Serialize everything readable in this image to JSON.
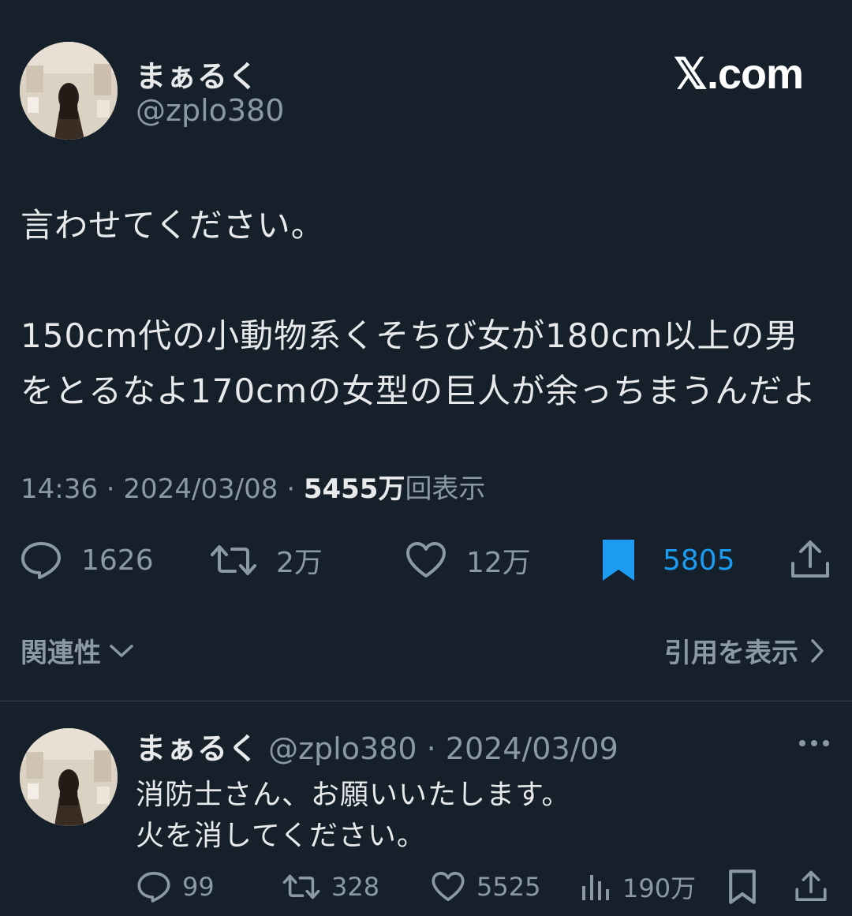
{
  "tweet": {
    "author": {
      "display_name": "まぁるく",
      "handle": "@zplo380"
    },
    "watermark": "𝕏.com",
    "lines": [
      "言わせてください。",
      "150cm代の小動物系くそちび女が180cm以上の男",
      "をとるなよ170cmの女型の巨人が余っちまうんだよ"
    ],
    "time": "14:36",
    "sep": "·",
    "date": "2024/03/08",
    "views_count": "5455万",
    "views_label": "回表示",
    "actions": {
      "replies": "1626",
      "retweets": "2万",
      "likes": "12万",
      "bookmarks": "5805"
    }
  },
  "sort": {
    "label": "関連性"
  },
  "quotes": {
    "label": "引用を表示"
  },
  "reply": {
    "display_name": "まぁるく",
    "handle": "@zplo380",
    "sep": "·",
    "date": "2024/03/09",
    "lines": [
      "消防士さん、お願いいたします。",
      "火を消してください。"
    ],
    "actions": {
      "replies": "99",
      "retweets": "328",
      "likes": "5525",
      "views": "190万"
    }
  },
  "colors": {
    "background": "#15202b",
    "text": "#e7e9ea",
    "muted": "#8b98a5",
    "accent": "#1d9bf0"
  },
  "icons": [
    "reply-icon",
    "retweet-icon",
    "heart-icon",
    "bookmark-icon",
    "share-icon",
    "chevron-down-icon",
    "chevron-right-icon",
    "more-icon",
    "views-icon"
  ]
}
